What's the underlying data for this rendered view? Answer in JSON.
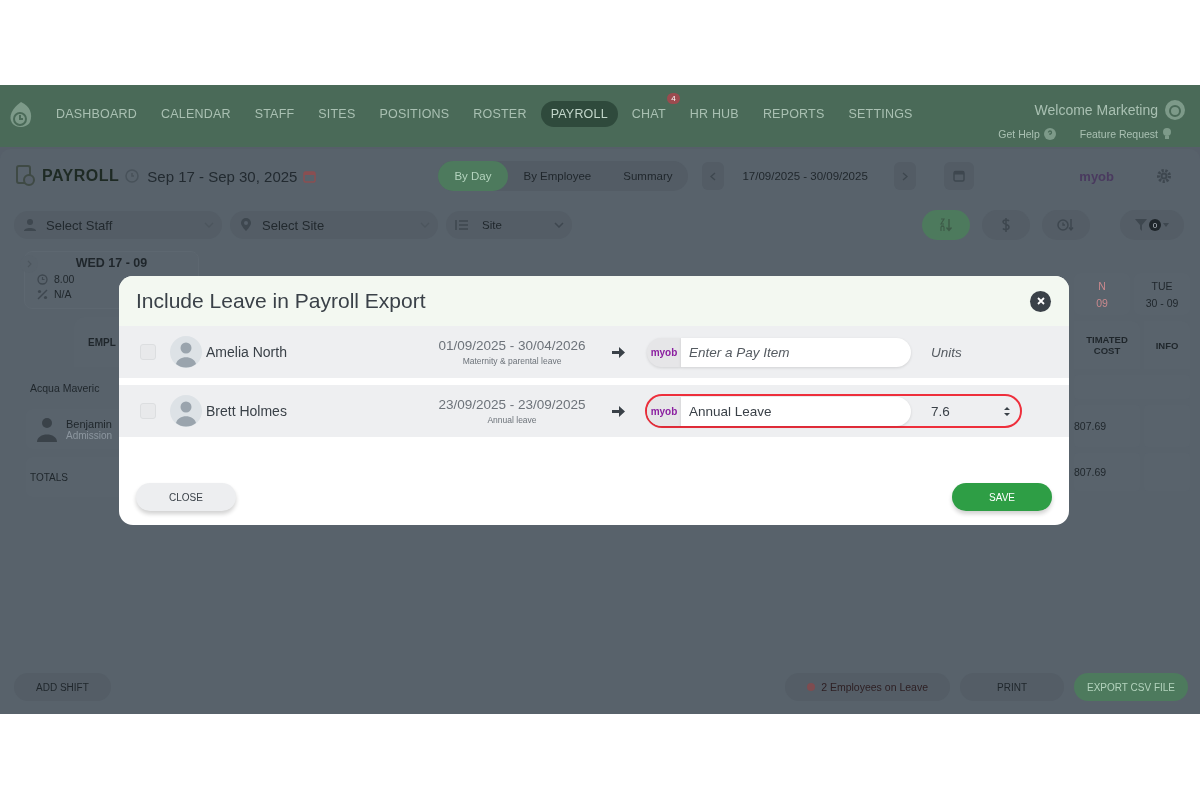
{
  "nav": {
    "items": [
      {
        "label": "DASHBOARD",
        "selected": false
      },
      {
        "label": "CALENDAR",
        "selected": false
      },
      {
        "label": "STAFF",
        "selected": false
      },
      {
        "label": "SITES",
        "selected": false
      },
      {
        "label": "POSITIONS",
        "selected": false
      },
      {
        "label": "ROSTER",
        "selected": false
      },
      {
        "label": "PAYROLL",
        "selected": true
      },
      {
        "label": "CHAT",
        "selected": false,
        "badge": "4"
      },
      {
        "label": "HR HUB",
        "selected": false
      },
      {
        "label": "REPORTS",
        "selected": false
      },
      {
        "label": "SETTINGS",
        "selected": false
      }
    ],
    "welcome": "Welcome Marketing",
    "help": "Get Help",
    "feature_request": "Feature Request"
  },
  "toolbar": {
    "title": "PAYROLL",
    "period": "Sep 17 - Sep 30, 2025",
    "views": [
      {
        "label": "By Day",
        "selected": true
      },
      {
        "label": "By Employee",
        "selected": false
      },
      {
        "label": "Summary",
        "selected": false
      }
    ],
    "date_range": "17/09/2025 - 30/09/2025",
    "provider": "myob"
  },
  "filters": {
    "staff_placeholder": "Select Staff",
    "site_placeholder": "Select Site",
    "group_by": "Site",
    "tools": [
      {
        "kind": "sort-az",
        "selected": true
      },
      {
        "kind": "dollar",
        "selected": false
      },
      {
        "kind": "clock-sort",
        "selected": false
      }
    ],
    "filter_count": "0"
  },
  "grid": {
    "day": "WED 17 - 09",
    "hours": "8.00",
    "percent": "N/A",
    "employee_header": "EMPL",
    "group": "Acqua Maveric",
    "employee": "Benjamin",
    "role": "Admission",
    "totals": "TOTALS",
    "right_days": [
      {
        "name": "N",
        "date": "09",
        "weekend": true
      },
      {
        "name": "TUE",
        "date": "30 - 09",
        "weekend": false
      }
    ],
    "cost_header": "TIMATED COST",
    "info_header": "INFO",
    "employee_cost": "807.69",
    "total_cost": "807.69"
  },
  "bottom": {
    "add_shift": "ADD SHIFT",
    "on_leave": "2 Employees on Leave",
    "print": "PRINT",
    "export": "EXPORT CSV FILE"
  },
  "modal": {
    "title": "Include Leave in Payroll Export",
    "rows": [
      {
        "name": "Amelia North",
        "checked": false,
        "dates": "01/09/2025 - 30/04/2026",
        "leave_type": "Maternity & parental leave",
        "provider": "myob",
        "pay_item": {
          "placeholder": "Enter a Pay Item"
        },
        "units": {
          "placeholder": "Units"
        },
        "highlighted": false
      },
      {
        "name": "Brett Holmes",
        "checked": false,
        "dates": "23/09/2025 - 23/09/2025",
        "leave_type": "Annual leave",
        "provider": "myob",
        "pay_item": {
          "value": "Annual Leave"
        },
        "units": {
          "value": "7.6"
        },
        "highlighted": true
      }
    ],
    "close": "CLOSE",
    "save": "SAVE"
  }
}
